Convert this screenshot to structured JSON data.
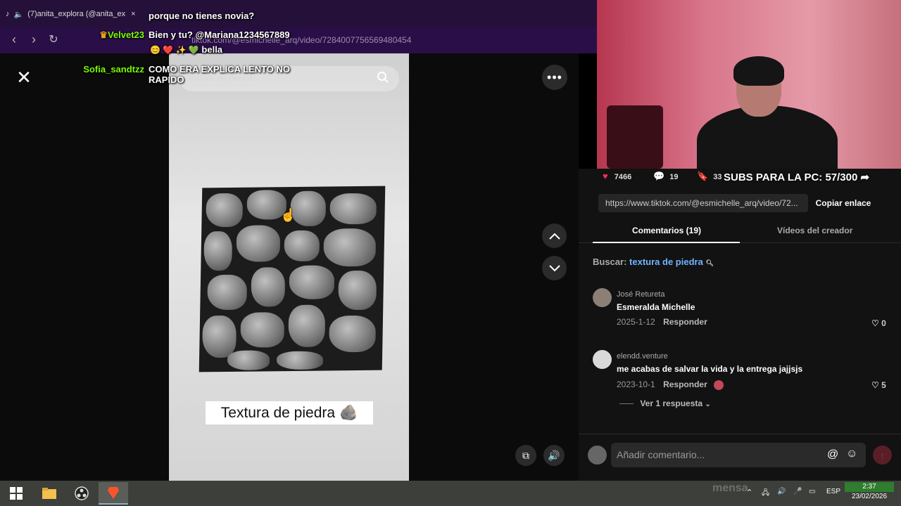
{
  "browser": {
    "tab_title": "(7)anita_explora (@anita_ex",
    "url": "tiktok.com/@esmichelle_arq/video/7284007756569480454"
  },
  "chat": [
    {
      "user": "",
      "text": "porque no tienes novia?",
      "user_color": "#ff4d4d"
    },
    {
      "user": "Velvet23",
      "text": "Bien y tu? @Mariana1234567889",
      "user_color": "#7cfc00"
    },
    {
      "user": "",
      "text": "bella",
      "user_color": "#ffffff"
    },
    {
      "user": "Sofia_sandtzz",
      "text": "COMO ERA EXPLICA LENTO NO",
      "text2": "RAPIDO",
      "user_color": "#7cfc00"
    }
  ],
  "video": {
    "search_placeholder": "textura de piedra",
    "caption": "Textura de piedra",
    "caption_emoji": "🪨"
  },
  "stats": {
    "likes": "7466",
    "comments": "19",
    "saves": "33"
  },
  "overlay": {
    "subs_text": "SUBS PARA LA PC: 57/300"
  },
  "panel": {
    "link": "https://www.tiktok.com/@esmichelle_arq/video/72...",
    "copy_label": "Copiar enlace",
    "tabs": [
      {
        "label": "Comentarios (19)"
      },
      {
        "label": "Vídeos del creador"
      }
    ],
    "search_label": "Buscar:",
    "search_query": "textura de piedra",
    "comments": [
      {
        "user": "José Retureta",
        "text": "Esmeralda Michelle",
        "date": "2025-1-12",
        "reply": "Responder",
        "likes": "0"
      },
      {
        "user": "elendd.venture",
        "text": "me acabas de salvar la vida y la entrega jajjsjs",
        "date": "2023-10-1",
        "reply": "Responder",
        "likes": "5"
      }
    ],
    "view_replies": "Ver 1 respuesta",
    "comment_placeholder": "Añadir comentario..."
  },
  "taskbar": {
    "lang": "ESP",
    "time": "2:37",
    "date": "23/02/2026",
    "ghost_text": "mensa"
  },
  "colors": {
    "tiktok_red": "#fe2c55",
    "link_blue": "#6fb5ff",
    "chat_green": "#7cfc00"
  }
}
